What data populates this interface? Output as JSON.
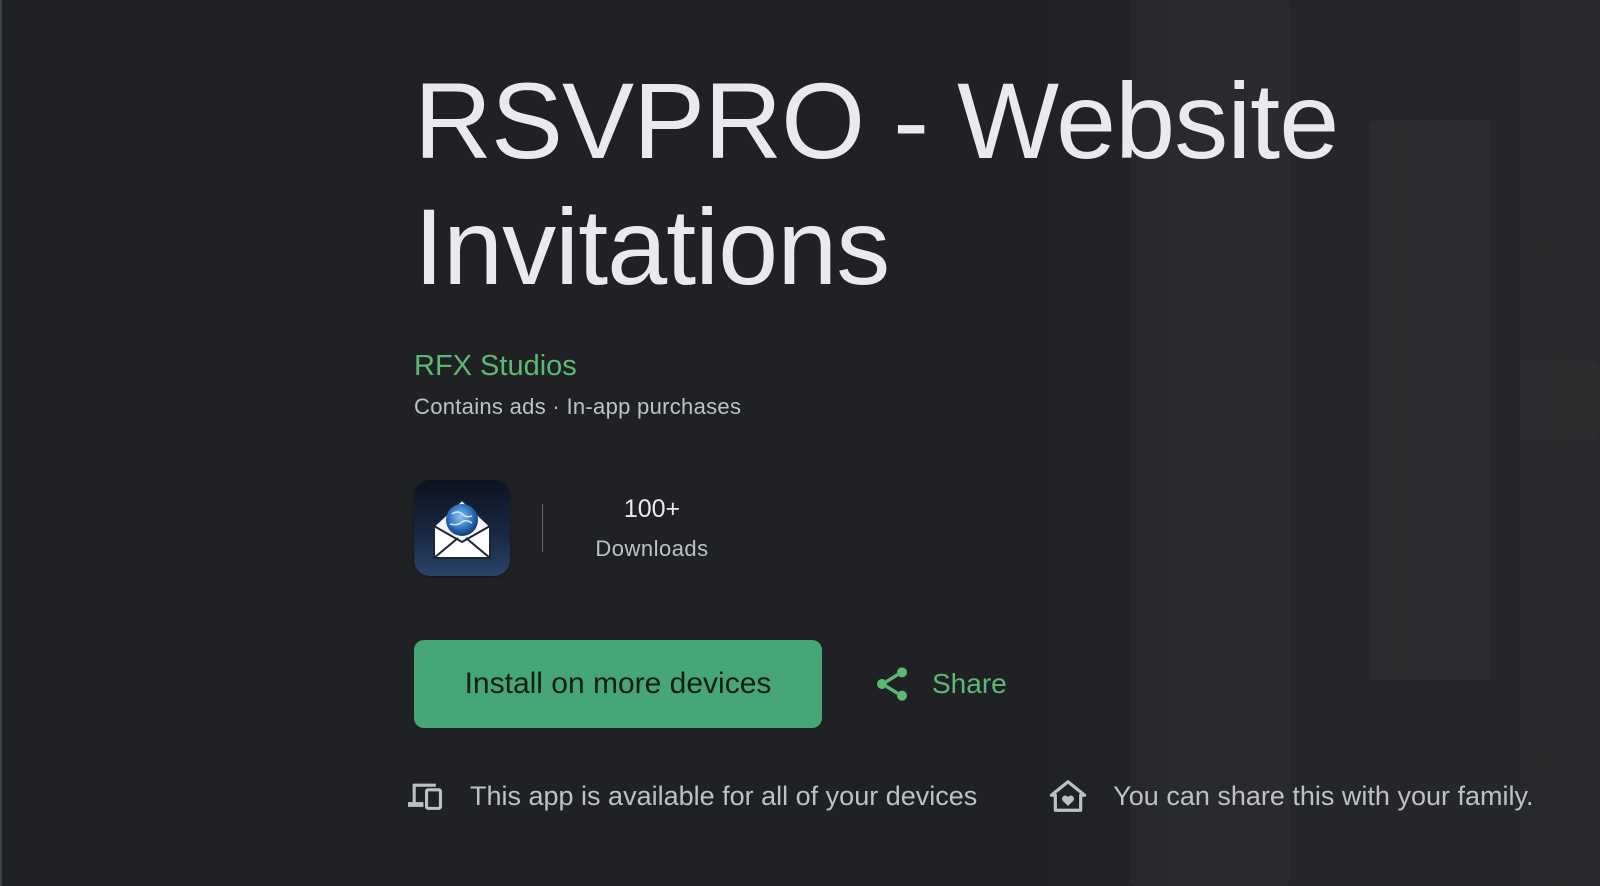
{
  "app": {
    "title": "RSVPRO - Website Invitations",
    "developer": "RFX Studios",
    "meta": "Contains ads · In-app purchases",
    "icon": "envelope-globe-icon"
  },
  "stats": [
    {
      "value": "100+",
      "label": "Downloads"
    }
  ],
  "actions": {
    "install_label": "Install on more devices",
    "share_label": "Share",
    "share_icon": "share-icon"
  },
  "availability": [
    {
      "icon": "devices-icon",
      "text": "This app is available for all of your devices"
    },
    {
      "icon": "family-home-icon",
      "text": "You can share this with your family."
    }
  ],
  "colors": {
    "background": "#202124",
    "accent": "#5bb974",
    "install_button": "#47a675",
    "primary_text": "#e8eaed",
    "secondary_text": "#bdc1c6"
  }
}
